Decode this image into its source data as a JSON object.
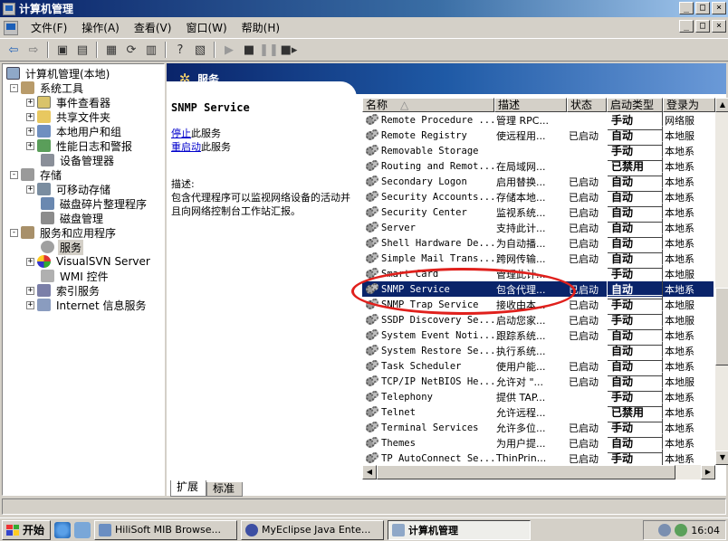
{
  "window": {
    "title": "计算机管理"
  },
  "menu": [
    "文件(F)",
    "操作(A)",
    "查看(V)",
    "窗口(W)",
    "帮助(H)"
  ],
  "winbtns": {
    "min": "_",
    "max": "□",
    "close": "×"
  },
  "toolbar": {
    "icons": [
      "back-arrow",
      "forward-arrow",
      "up-folder",
      "show-hide-tree",
      "properties",
      "refresh",
      "export-list",
      "help",
      "show-hide-action-pane",
      "play",
      "stop",
      "pause",
      "restart"
    ]
  },
  "tree": [
    {
      "label": "计算机管理(本地)",
      "level": 0,
      "expander": "",
      "icon": "computer"
    },
    {
      "label": "系统工具",
      "level": 1,
      "expander": "-",
      "icon": "tools"
    },
    {
      "label": "事件查看器",
      "level": 2,
      "expander": "+",
      "icon": "event"
    },
    {
      "label": "共享文件夹",
      "level": 2,
      "expander": "+",
      "icon": "folder"
    },
    {
      "label": "本地用户和组",
      "level": 2,
      "expander": "+",
      "icon": "users"
    },
    {
      "label": "性能日志和警报",
      "level": 2,
      "expander": "+",
      "icon": "perf"
    },
    {
      "label": "设备管理器",
      "level": 2,
      "expander": "",
      "icon": "device"
    },
    {
      "label": "存储",
      "level": 1,
      "expander": "-",
      "icon": "storage"
    },
    {
      "label": "可移动存储",
      "level": 2,
      "expander": "+",
      "icon": "removable"
    },
    {
      "label": "磁盘碎片整理程序",
      "level": 2,
      "expander": "",
      "icon": "defrag"
    },
    {
      "label": "磁盘管理",
      "level": 2,
      "expander": "",
      "icon": "disk"
    },
    {
      "label": "服务和应用程序",
      "level": 1,
      "expander": "-",
      "icon": "apps"
    },
    {
      "label": "服务",
      "level": 2,
      "expander": "",
      "icon": "gear",
      "selected": true
    },
    {
      "label": "VisualSVN Server",
      "level": 2,
      "expander": "+",
      "icon": "svn"
    },
    {
      "label": "WMI 控件",
      "level": 2,
      "expander": "",
      "icon": "wmi"
    },
    {
      "label": "索引服务",
      "level": 2,
      "expander": "+",
      "icon": "index"
    },
    {
      "label": "Internet 信息服务",
      "level": 2,
      "expander": "+",
      "icon": "iis"
    }
  ],
  "header": {
    "title": "服务"
  },
  "detail": {
    "service_name": "SNMP Service",
    "stop_link": "停止",
    "stop_suffix": "此服务",
    "restart_link": "重启动",
    "restart_suffix": "此服务",
    "desc_label": "描述:",
    "desc_text": "包含代理程序可以监视网络设备的活动并且向网络控制台工作站汇报。"
  },
  "columns": [
    "名称",
    "描述",
    "状态",
    "启动类型",
    "登录为"
  ],
  "services": [
    {
      "name": "Remote Procedure ...",
      "desc": "管理 RPC...",
      "status": "",
      "startup": "手动",
      "login": "网络服"
    },
    {
      "name": "Remote Registry",
      "desc": "使远程用...",
      "status": "已启动",
      "startup": "自动",
      "login": "本地服"
    },
    {
      "name": "Removable Storage",
      "desc": "",
      "status": "",
      "startup": "手动",
      "login": "本地系"
    },
    {
      "name": "Routing and Remot...",
      "desc": "在局域网...",
      "status": "",
      "startup": "已禁用",
      "login": "本地系"
    },
    {
      "name": "Secondary Logon",
      "desc": "启用替换...",
      "status": "已启动",
      "startup": "自动",
      "login": "本地系"
    },
    {
      "name": "Security Accounts...",
      "desc": "存储本地...",
      "status": "已启动",
      "startup": "自动",
      "login": "本地系"
    },
    {
      "name": "Security Center",
      "desc": "监视系统...",
      "status": "已启动",
      "startup": "自动",
      "login": "本地系"
    },
    {
      "name": "Server",
      "desc": "支持此计...",
      "status": "已启动",
      "startup": "自动",
      "login": "本地系"
    },
    {
      "name": "Shell Hardware De...",
      "desc": "为自动播...",
      "status": "已启动",
      "startup": "自动",
      "login": "本地系"
    },
    {
      "name": "Simple Mail Trans...",
      "desc": "跨网传输...",
      "status": "已启动",
      "startup": "自动",
      "login": "本地系"
    },
    {
      "name": "Smart Card",
      "desc": "管理此计...",
      "status": "",
      "startup": "手动",
      "login": "本地服"
    },
    {
      "name": "SNMP Service",
      "desc": "包含代理...",
      "status": "已启动",
      "startup": "自动",
      "login": "本地系",
      "selected": true
    },
    {
      "name": "SNMP Trap Service",
      "desc": "接收由本...",
      "status": "已启动",
      "startup": "手动",
      "login": "本地服"
    },
    {
      "name": "SSDP Discovery Se...",
      "desc": "启动您家...",
      "status": "已启动",
      "startup": "手动",
      "login": "本地服"
    },
    {
      "name": "System Event Noti...",
      "desc": "跟踪系统...",
      "status": "已启动",
      "startup": "自动",
      "login": "本地系"
    },
    {
      "name": "System Restore Se...",
      "desc": "执行系统...",
      "status": "",
      "startup": "自动",
      "login": "本地系"
    },
    {
      "name": "Task Scheduler",
      "desc": "使用户能...",
      "status": "已启动",
      "startup": "自动",
      "login": "本地系"
    },
    {
      "name": "TCP/IP NetBIOS He...",
      "desc": "允许对 \"...",
      "status": "已启动",
      "startup": "自动",
      "login": "本地服"
    },
    {
      "name": "Telephony",
      "desc": "提供 TAP...",
      "status": "",
      "startup": "手动",
      "login": "本地系"
    },
    {
      "name": "Telnet",
      "desc": "允许远程...",
      "status": "",
      "startup": "已禁用",
      "login": "本地系"
    },
    {
      "name": "Terminal Services",
      "desc": "允许多位...",
      "status": "已启动",
      "startup": "手动",
      "login": "本地系"
    },
    {
      "name": "Themes",
      "desc": "为用户提...",
      "status": "已启动",
      "startup": "自动",
      "login": "本地系"
    },
    {
      "name": "TP AutoConnect Se...",
      "desc": "ThinPrin...",
      "status": "已启动",
      "startup": "手动",
      "login": "本地系"
    }
  ],
  "tabs": [
    "扩展",
    "标准"
  ],
  "taskbar": {
    "start": "开始",
    "tasks": [
      "HiliSoft MIB Browse...",
      "MyEclipse Java Ente...",
      "计算机管理"
    ],
    "clock": "16:04"
  },
  "colors": {
    "selection": "#0a246a",
    "annotation": "#e0201c"
  }
}
